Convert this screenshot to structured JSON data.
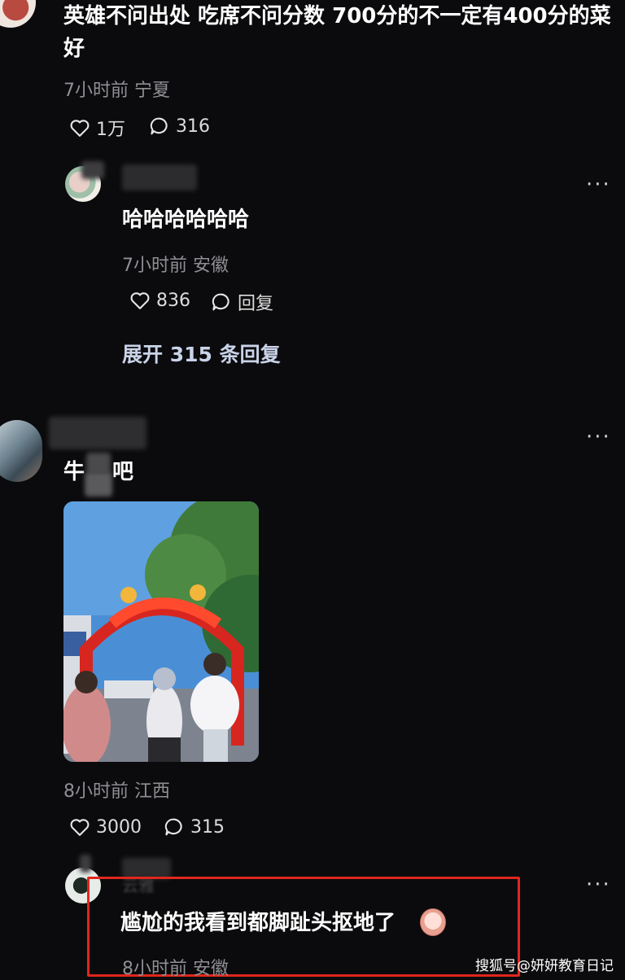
{
  "comment1": {
    "text": "英雄不问出处 吃席不问分数 700分的不一定有400分的菜好",
    "meta": "7小时前 宁夏",
    "likes": "1万",
    "replies": "316"
  },
  "reply1": {
    "text": "哈哈哈哈哈哈",
    "meta": "7小时前 安徽",
    "likes": "836",
    "reply_label": "回复",
    "expand_label": "展开 315 条回复"
  },
  "comment2": {
    "text_left": "牛",
    "text_right": "吧",
    "meta": "8小时前 江西",
    "likes": "3000",
    "replies": "315"
  },
  "reply2": {
    "username": "云雅",
    "text": "尴尬的我看到都脚趾头抠地了",
    "meta": "8小时前 安徽"
  },
  "more_label": "···",
  "watermark": "搜狐号@妍妍教育日记",
  "colors": {
    "background": "#0b0b0d",
    "highlight_border": "#e0261e",
    "meta_text": "#8f8f95"
  }
}
